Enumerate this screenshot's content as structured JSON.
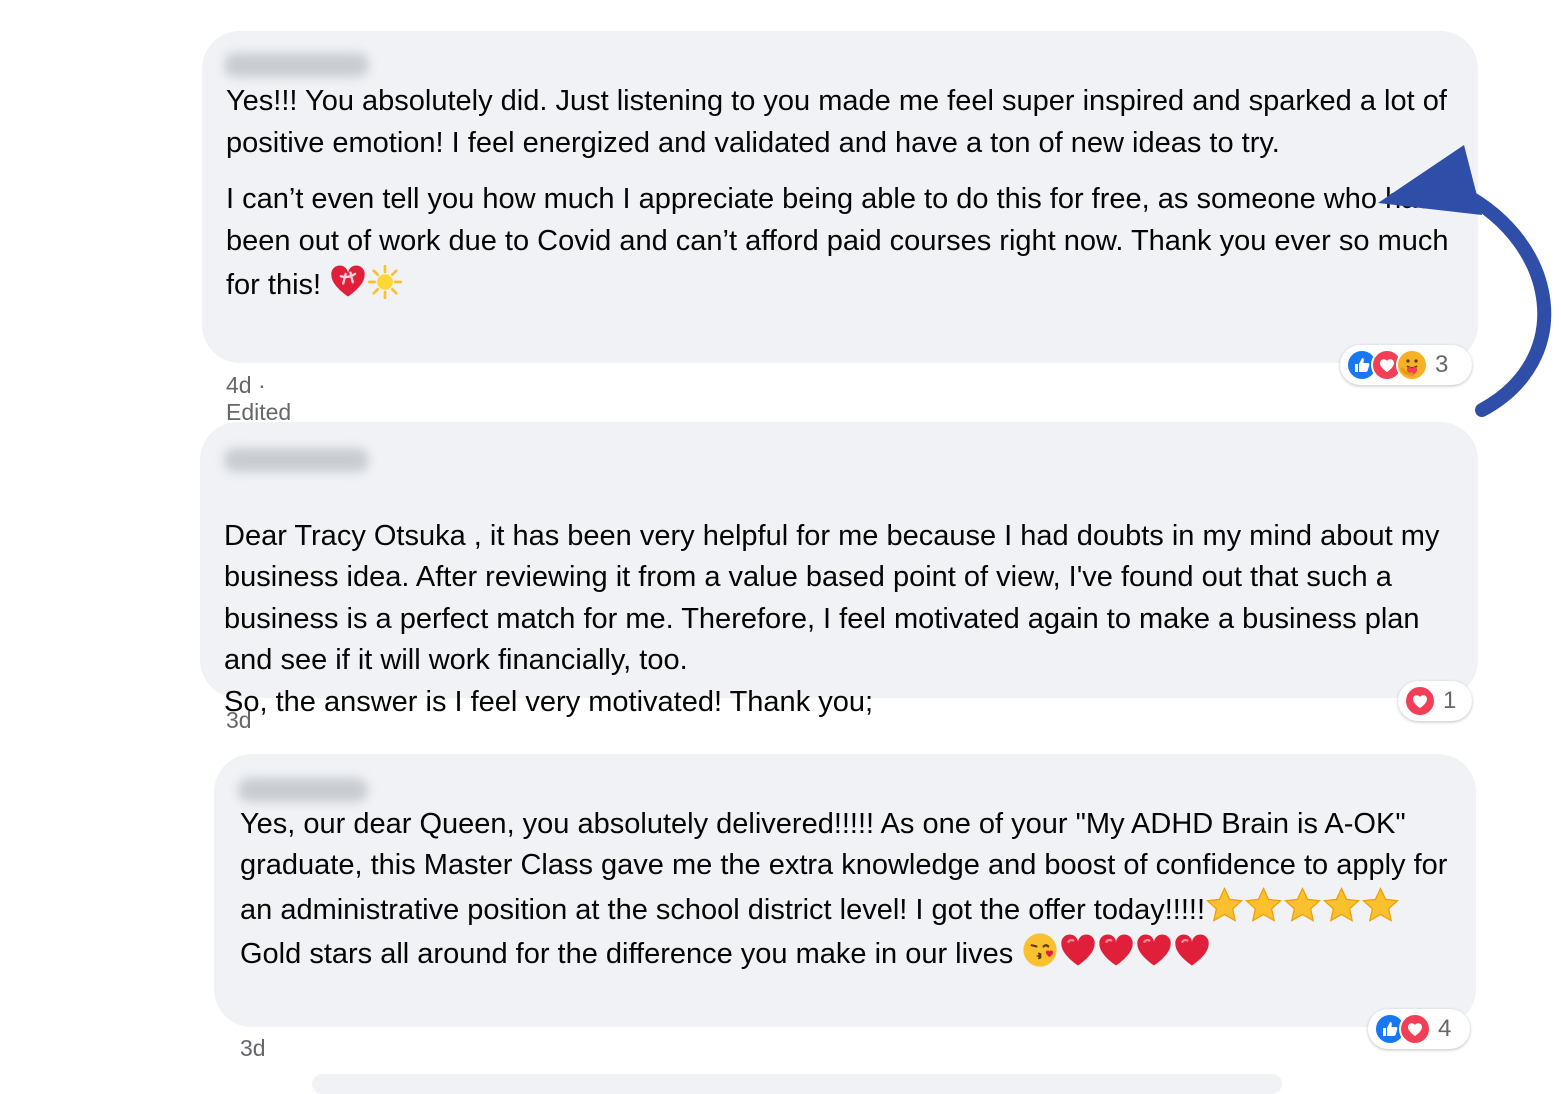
{
  "comments": [
    {
      "paragraphs": [
        "Yes!!! You absolutely did. Just listening to you made me feel super inspired and sparked a lot of positive emotion! I feel energized and validated and have a ton of new ideas to try.",
        "I can’t even tell you how much I appreciate being able to do this for free, as someone who has been out of work due to Covid and can’t afford paid courses right now. Thank you ever so much for this!"
      ],
      "meta": "4d · Edited",
      "reaction_icons": [
        "like-icon",
        "love-icon",
        "care-icon"
      ],
      "reaction_count": "3",
      "trailing_emoji": [
        "heart-with-ribbon-icon",
        "sun-icon"
      ]
    },
    {
      "paragraphs": [
        "Dear Tracy Otsuka , it has been very helpful for me because I had doubts in my mind about my business idea. After reviewing it from a value based point of view, I've found out that such a business is a perfect match for me. Therefore, I feel motivated again to make a business plan and see if it will work financially, too.\nSo, the answer is I feel very motivated! Thank you;"
      ],
      "meta": "3d",
      "reaction_icons": [
        "love-icon"
      ],
      "reaction_count": "1"
    },
    {
      "paragraphs": [
        "Yes, our dear Queen, you absolutely delivered!!!!! As one of your \"My ADHD Brain is A-OK\" graduate, this Master Class gave me the extra knowledge and boost of confidence to apply for an administrative position at the school district level! I got the offer today!!!!!",
        " Gold stars all around for the difference you make in our lives "
      ],
      "meta": "3d",
      "reaction_icons": [
        "like-icon",
        "love-icon"
      ],
      "reaction_count": "4",
      "inline_emoji": [
        "star-icon",
        "star-icon",
        "star-icon",
        "star-icon",
        "star-icon"
      ],
      "trailing_emoji": [
        "kissing-face-icon",
        "heart-icon",
        "heart-icon",
        "heart-icon",
        "heart-icon"
      ]
    }
  ],
  "colors": {
    "bubble": "#f0f2f5",
    "meta_text": "#65676b",
    "arrow": "#2f4ea8",
    "like": "#1877f2",
    "love": "#f33e58",
    "care": "#f7b125"
  }
}
